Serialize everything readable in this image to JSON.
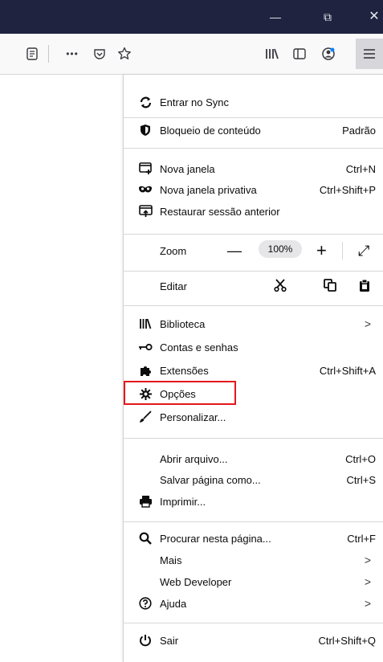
{
  "window": {
    "minimize": "—",
    "restore": "⧉",
    "close": "✕"
  },
  "toolbar": {
    "icons": [
      "reader-view-icon",
      "more-actions-icon",
      "pocket-icon",
      "bookmark-star-icon",
      "library-icon",
      "sidebar-icon",
      "account-icon",
      "hamburger-menu-icon"
    ],
    "more": "•••"
  },
  "menu": {
    "sync": "Entrar no Sync",
    "content_blocking": {
      "label": "Bloqueio de conteúdo",
      "value": "Padrão"
    },
    "new_window": {
      "label": "Nova janela",
      "shortcut": "Ctrl+N"
    },
    "private_window": {
      "label": "Nova janela privativa",
      "shortcut": "Ctrl+Shift+P"
    },
    "restore_session": "Restaurar sessão anterior",
    "zoom": {
      "label": "Zoom",
      "minus": "—",
      "value": "100%",
      "plus": "+",
      "expand": "⤢"
    },
    "edit": {
      "label": "Editar"
    },
    "library": "Biblioteca",
    "logins": "Contas e senhas",
    "addons": {
      "label": "Extensões",
      "shortcut": "Ctrl+Shift+A"
    },
    "options": "Opções",
    "customize": "Personalizar...",
    "open_file": {
      "label": "Abrir arquivo...",
      "shortcut": "Ctrl+O"
    },
    "save_page": {
      "label": "Salvar página como...",
      "shortcut": "Ctrl+S"
    },
    "print": "Imprimir...",
    "find": {
      "label": "Procurar nesta página...",
      "shortcut": "Ctrl+F"
    },
    "more": "Mais",
    "web_developer": "Web Developer",
    "help": "Ajuda",
    "quit": {
      "label": "Sair",
      "shortcut": "Ctrl+Shift+Q"
    },
    "arrow": ">"
  },
  "colors": {
    "titlebar": "#202340",
    "highlight": "#e5171e"
  }
}
